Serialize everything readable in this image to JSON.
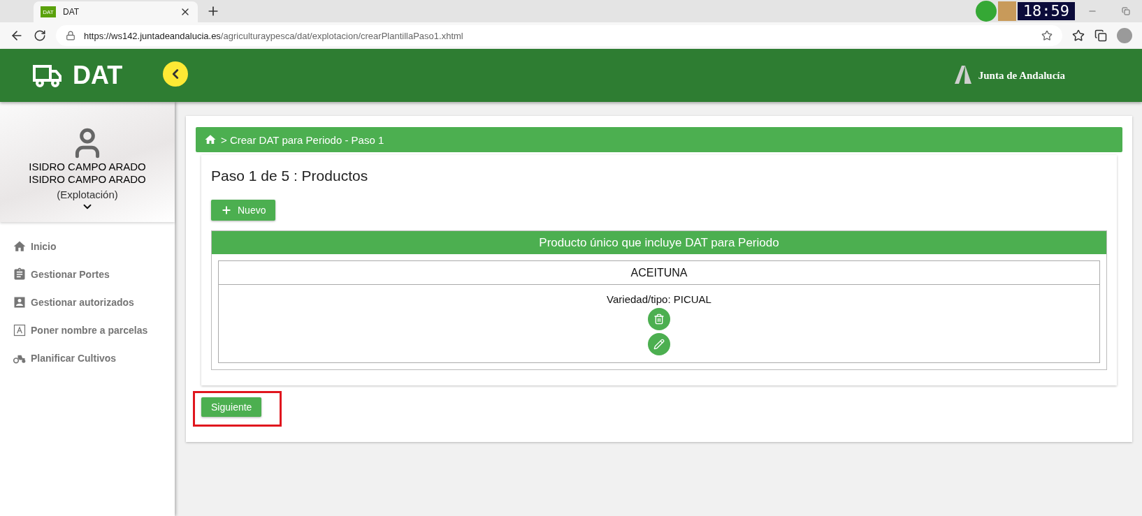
{
  "browser": {
    "tab_title": "DAT",
    "tab_favicon": "DAT",
    "url_host": "https://ws142.juntadeandalucia.es",
    "url_path": "/agriculturaypesca/dat/explotacion/crearPlantillaPaso1.xhtml",
    "clock": "18:59"
  },
  "header": {
    "app_title": "DAT",
    "org_name": "Junta de Andalucía"
  },
  "user": {
    "name_lines": [
      "ISIDRO CAMPO ARADO",
      "ISIDRO CAMPO ARADO"
    ],
    "role": "(Explotación)"
  },
  "sidebar": {
    "items": [
      {
        "kind": "home",
        "label": "Inicio"
      },
      {
        "kind": "clipboard",
        "label": "Gestionar Portes"
      },
      {
        "kind": "contact",
        "label": "Gestionar autorizados"
      },
      {
        "kind": "text-frame",
        "label": "Poner nombre a parcelas"
      },
      {
        "kind": "tractor",
        "label": "Planificar Cultivos"
      }
    ]
  },
  "breadcrumb": "> Crear DAT para Periodo - Paso 1",
  "step_title": "Paso 1 de 5 : Productos",
  "new_button": "Nuevo",
  "product_panel": {
    "title": "Producto único que incluye DAT para Periodo",
    "product": "ACEITUNA",
    "variety": "Variedad/tipo: PICUAL"
  },
  "next_button": {
    "label": "Siguiente",
    "highlighted": true
  }
}
